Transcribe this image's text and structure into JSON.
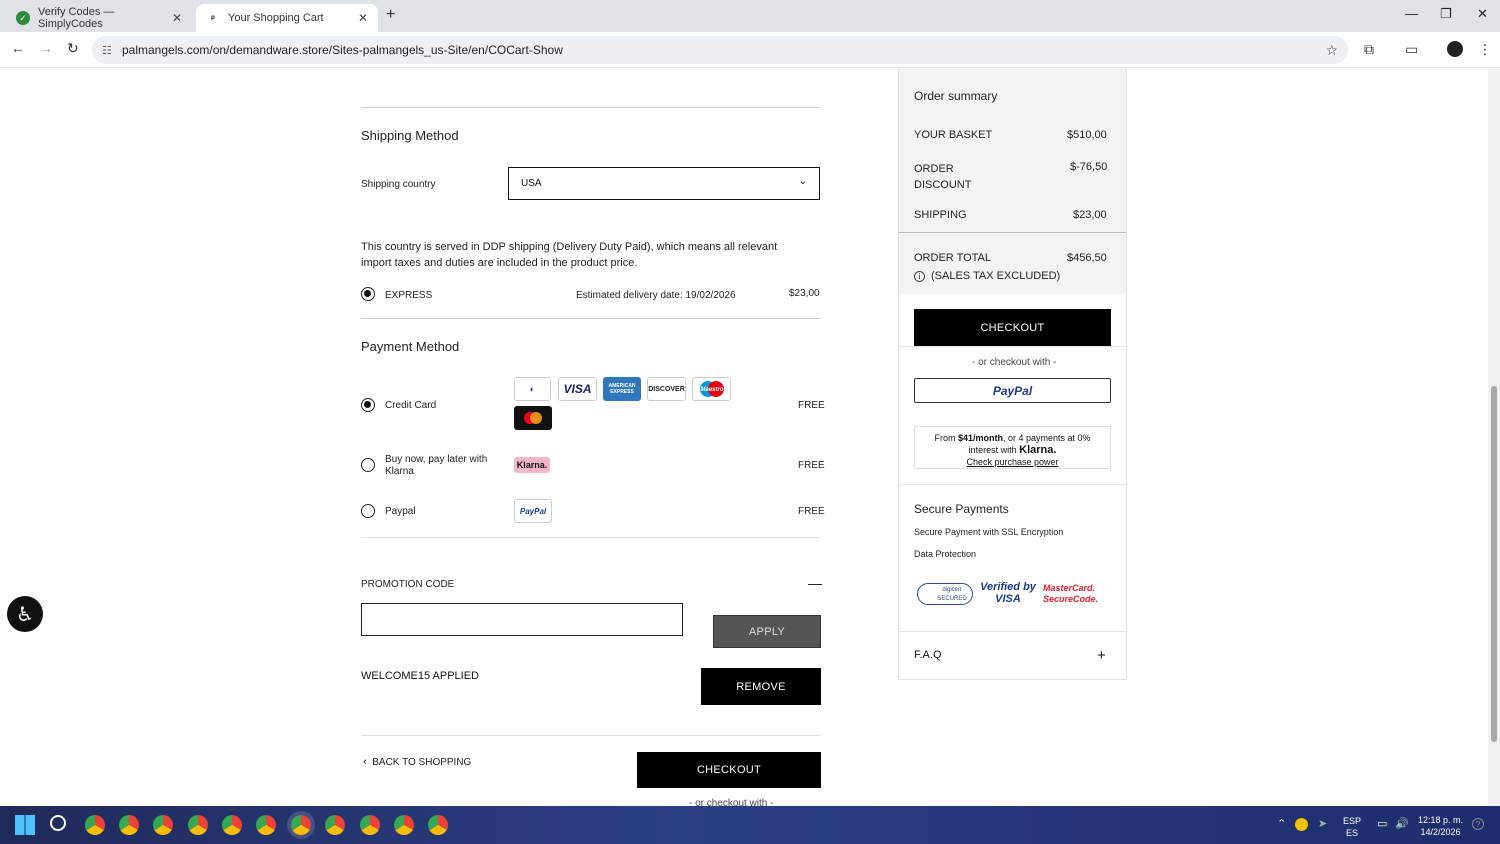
{
  "browser": {
    "tabs": [
      {
        "title": "Verify Codes — SimplyCodes"
      },
      {
        "title": "Your Shopping Cart"
      }
    ],
    "url": "palmangels.com/on/demandware.store/Sites-palmangels_us-Site/en/COCart-Show"
  },
  "shipping": {
    "title": "Shipping Method",
    "country_label": "Shipping country",
    "country_value": "USA",
    "ddp_note": "This country is served in DDP shipping (Delivery Duty Paid), which means all relevant import taxes and duties are included in the product price.",
    "option_label": "EXPRESS",
    "delivery_date": "Estimated delivery date: 19/02/2026",
    "option_price": "$23,00"
  },
  "payment": {
    "title": "Payment Method",
    "methods": [
      {
        "label": "Credit Card",
        "price": "FREE"
      },
      {
        "label": "Buy now, pay later with Klarna",
        "price": "FREE"
      },
      {
        "label": "Paypal",
        "price": "FREE"
      }
    ],
    "card_logos": [
      "Diners Club",
      "VISA",
      "AMERICAN EXPRESS",
      "DISCOVER",
      "Maestro",
      "mastercard"
    ],
    "klarna_logo": "Klarna.",
    "paypal_logo": "PayPal"
  },
  "promo": {
    "label": "PROMOTION CODE",
    "collapse_icon": "minus-icon",
    "input_value": "",
    "apply_label": "APPLY",
    "applied_text": "WELCOME15 APPLIED",
    "remove_label": "REMOVE"
  },
  "footer": {
    "back_label": "BACK TO SHOPPING",
    "checkout_label": "CHECKOUT",
    "or_checkout": "- or checkout with -"
  },
  "summary": {
    "title": "Order summary",
    "rows": [
      {
        "label": "YOUR BASKET",
        "value": "$510,00"
      },
      {
        "label": "ORDER DISCOUNT",
        "value": "$-76,50"
      },
      {
        "label": "SHIPPING",
        "value": "$23,00"
      }
    ],
    "total_label": "ORDER TOTAL",
    "total_value": "$456,50",
    "tax_note": "(SALES TAX EXCLUDED)",
    "checkout_label": "CHECKOUT",
    "or_checkout": "- or checkout with -",
    "paypal_label": "PayPal",
    "klarna_line1_pre": "From ",
    "klarna_amount": "$41/month",
    "klarna_line1_post": ", or 4 payments at 0%",
    "klarna_line2": "interest with",
    "klarna_logo": "Klarna.",
    "klarna_link": "Check purchase power"
  },
  "secure": {
    "title": "Secure Payments",
    "line1": "Secure Payment with SSL Encryption",
    "line2": "Data Protection",
    "badges": [
      "digicert SECURED",
      "Verified by VISA",
      "MasterCard. SecureCode."
    ]
  },
  "faq": {
    "label": "F.A.Q",
    "icon": "plus-icon"
  },
  "taskbar": {
    "lang_top": "ESP",
    "lang_bottom": "ES",
    "time": "12:18 p. m.",
    "date": "14/2/2026"
  }
}
